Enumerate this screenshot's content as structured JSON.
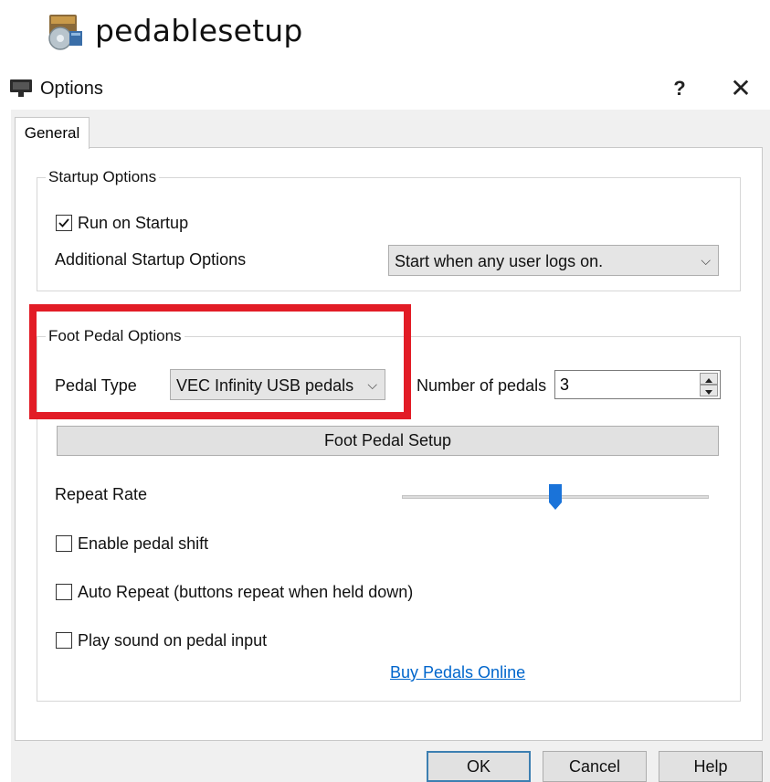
{
  "app": {
    "name": "pedablesetup",
    "icon": "software-box-icon"
  },
  "dialog": {
    "title": "Options",
    "help_label": "?",
    "close_label": "✕",
    "tabs": [
      {
        "label": "General"
      }
    ]
  },
  "startup": {
    "group_title": "Startup Options",
    "run_on_startup": {
      "label": "Run on Startup",
      "checked": true
    },
    "additional_label": "Additional Startup Options",
    "additional_value": "Start when any user logs on."
  },
  "foot_pedal": {
    "group_title": "Foot Pedal Options",
    "pedal_type_label": "Pedal Type",
    "pedal_type_value": "VEC Infinity USB pedals",
    "num_pedals_label": "Number of pedals",
    "num_pedals_value": "3",
    "setup_button": "Foot Pedal Setup",
    "repeat_rate_label": "Repeat Rate",
    "repeat_rate_level": 0.5,
    "enable_shift": {
      "label": "Enable pedal shift",
      "checked": false
    },
    "auto_repeat": {
      "label": "Auto Repeat (buttons repeat when held down)",
      "checked": false
    },
    "play_sound": {
      "label": "Play sound on pedal input",
      "checked": false
    },
    "buy_link": "Buy Pedals Online"
  },
  "buttons": {
    "ok": "OK",
    "cancel": "Cancel",
    "help": "Help"
  },
  "colors": {
    "highlight": "#e21c26",
    "link": "#0066cc",
    "slider_thumb": "#1a73d9",
    "default_button_border": "#3c7fb1"
  }
}
